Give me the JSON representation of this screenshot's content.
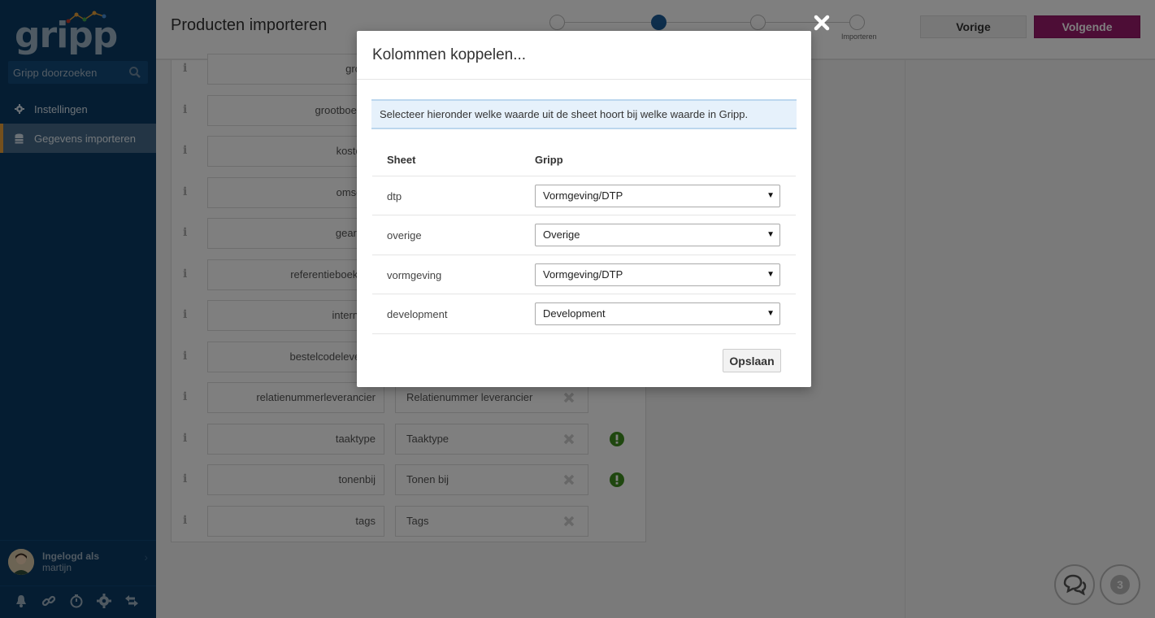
{
  "app": {
    "logo_text": "gripp",
    "brand_color": "#9b1a6d",
    "sidebar_color": "#0b3a64"
  },
  "sidebar": {
    "search_placeholder": "Gripp doorzoeken",
    "items": [
      {
        "label": "Instellingen",
        "icon": "gear-icon"
      },
      {
        "label": "Gegevens importeren",
        "icon": "database-icon",
        "active": true
      }
    ],
    "user": {
      "label": "Ingelogd als",
      "name": "martijn"
    },
    "footer_icons": [
      "bell-icon",
      "link-icon",
      "timer-icon",
      "gear-icon",
      "swap-icon"
    ]
  },
  "header": {
    "title": "Producten importeren",
    "steps": {
      "last_label": "Importeren",
      "active_index": 1,
      "count": 4
    },
    "prev_label": "Vorige",
    "next_label": "Volgende"
  },
  "background_rows": [
    {
      "source": "grootb",
      "target": "",
      "x": false,
      "warn": false
    },
    {
      "source": "grootboekink",
      "target": "",
      "x": false,
      "warn": false
    },
    {
      "source": "kostenpl",
      "target": "",
      "x": false,
      "warn": false
    },
    {
      "source": "omschrij",
      "target": "",
      "x": false,
      "warn": false
    },
    {
      "source": "gearchiv",
      "target": "",
      "x": false,
      "warn": false
    },
    {
      "source": "referentieboekhou",
      "target": "",
      "x": false,
      "warn": false
    },
    {
      "source": "internenc",
      "target": "",
      "x": false,
      "warn": false
    },
    {
      "source": "bestelcodeleveran",
      "target": "",
      "x": false,
      "warn": false
    },
    {
      "source": "relatienummerleverancier",
      "target": "Relatienummer leverancier",
      "x": true,
      "warn": false
    },
    {
      "source": "taaktype",
      "target": "Taaktype",
      "x": true,
      "warn": true
    },
    {
      "source": "tonenbij",
      "target": "Tonen bij",
      "x": true,
      "warn": true
    },
    {
      "source": "tags",
      "target": "Tags",
      "x": true,
      "warn": false
    }
  ],
  "modal": {
    "title": "Kolommen koppelen...",
    "info": "Selecteer hieronder welke waarde uit de sheet hoort bij welke waarde in Gripp.",
    "col_sheet": "Sheet",
    "col_gripp": "Gripp",
    "rows": [
      {
        "sheet": "dtp",
        "gripp": "Vormgeving/DTP"
      },
      {
        "sheet": "overige",
        "gripp": "Overige"
      },
      {
        "sheet": "vormgeving",
        "gripp": "Vormgeving/DTP"
      },
      {
        "sheet": "development",
        "gripp": "Development"
      }
    ],
    "save_label": "Opslaan"
  },
  "help": {
    "badge": "3"
  }
}
